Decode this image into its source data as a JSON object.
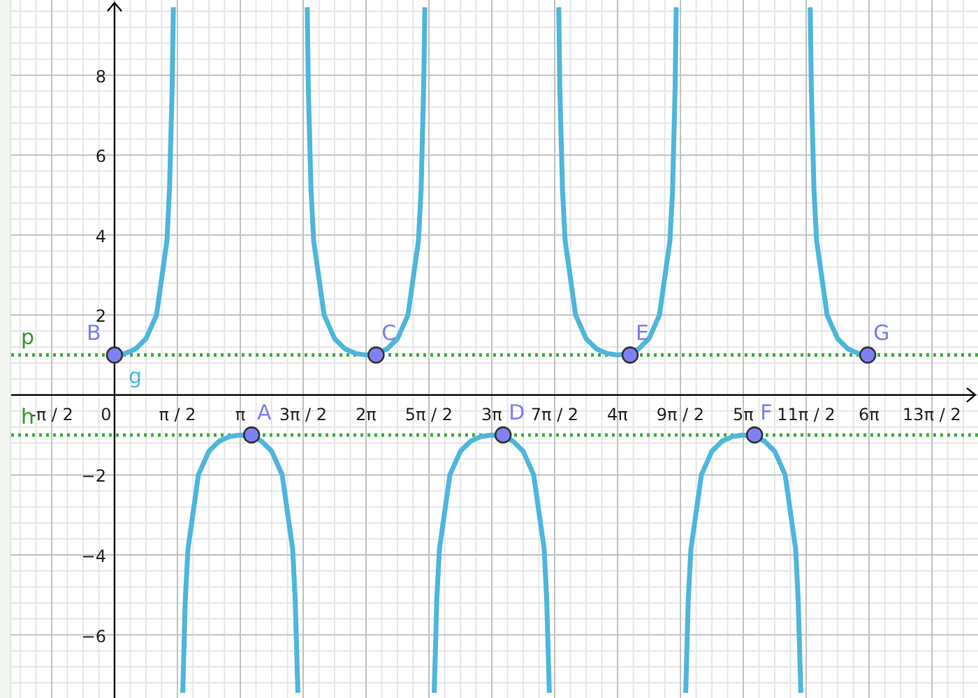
{
  "chart_data": {
    "type": "line",
    "xlim": [
      -2.582,
      21.573
    ],
    "ylim": [
      -7.58,
      9.88
    ],
    "grid": true,
    "xticks": [
      {
        "value": -1.571,
        "label": "-π / 2"
      },
      {
        "value": 0,
        "label": "0"
      },
      {
        "value": 1.571,
        "label": "π / 2"
      },
      {
        "value": 3.142,
        "label": "π"
      },
      {
        "value": 4.712,
        "label": "3π / 2"
      },
      {
        "value": 6.283,
        "label": "2π"
      },
      {
        "value": 7.854,
        "label": "5π / 2"
      },
      {
        "value": 9.425,
        "label": "3π"
      },
      {
        "value": 10.996,
        "label": "7π / 2"
      },
      {
        "value": 12.566,
        "label": "4π"
      },
      {
        "value": 14.137,
        "label": "9π / 2"
      },
      {
        "value": 15.708,
        "label": "5π"
      },
      {
        "value": 17.279,
        "label": "11π / 2"
      },
      {
        "value": 18.85,
        "label": "6π"
      },
      {
        "value": 20.42,
        "label": "13π / 2"
      }
    ],
    "yticks": [
      {
        "value": -6,
        "label": "−6"
      },
      {
        "value": -4,
        "label": "−4"
      },
      {
        "value": -2,
        "label": "−2"
      },
      {
        "value": 2,
        "label": "2"
      },
      {
        "value": 4,
        "label": "4"
      },
      {
        "value": 6,
        "label": "6"
      },
      {
        "value": 8,
        "label": "8"
      }
    ],
    "x": [
      0,
      0.262,
      0.524,
      0.785,
      1.047,
      1.309,
      1.374,
      1.44,
      1.469,
      1.571,
      1.704,
      1.767,
      1.833,
      2.094,
      2.356,
      2.618,
      2.88,
      3.142,
      3.403,
      3.665,
      3.927,
      4.189,
      4.451,
      4.516,
      4.58,
      4.712,
      4.814,
      4.843,
      4.909,
      4.974,
      5.236,
      5.498,
      5.76,
      6.021,
      6.283,
      6.545,
      6.807,
      7.069,
      7.33,
      7.592,
      7.658,
      7.723,
      7.752,
      7.854,
      7.987,
      8.05,
      8.116,
      8.378,
      8.639,
      8.901,
      9.163,
      9.425,
      9.687,
      9.948,
      10.21,
      10.472,
      10.734,
      10.799,
      10.863,
      10.996,
      11.097,
      11.127,
      11.192,
      11.257,
      11.519,
      11.781,
      12.043,
      12.305,
      12.566,
      12.828,
      13.09,
      13.352,
      13.614,
      13.875,
      13.941,
      14.006,
      14.035,
      14.137,
      14.27,
      14.334,
      14.399,
      14.661,
      14.923,
      15.184,
      15.446,
      15.708,
      15.97,
      16.232,
      16.493,
      16.755,
      17.017,
      17.082,
      17.146,
      17.279,
      17.381,
      17.41,
      17.475,
      17.541,
      17.802,
      18.064,
      18.326,
      18.588,
      18.85
    ],
    "series": [
      {
        "name": "g",
        "color": "#4db6dc",
        "values": [
          1,
          1.04,
          1.15,
          1.41,
          2,
          3.86,
          5.13,
          7.66,
          9.7,
          null,
          -7.45,
          -5.13,
          -3.86,
          -2,
          -1.41,
          -1.15,
          -1.04,
          -1,
          -1.04,
          -1.15,
          -1.41,
          -2,
          -3.86,
          -5.13,
          -7.45,
          null,
          9.7,
          7.66,
          5.13,
          3.86,
          2,
          1.41,
          1.15,
          1.04,
          1,
          1.04,
          1.15,
          1.41,
          2,
          3.86,
          5.13,
          7.66,
          9.7,
          null,
          -7.45,
          -5.13,
          -3.86,
          -2,
          -1.41,
          -1.15,
          -1.04,
          -1,
          -1.04,
          -1.15,
          -1.41,
          -2,
          -3.86,
          -5.13,
          -7.45,
          null,
          9.7,
          7.66,
          5.13,
          3.86,
          2,
          1.41,
          1.15,
          1.04,
          1,
          1.04,
          1.15,
          1.41,
          2,
          3.86,
          5.13,
          7.66,
          9.7,
          null,
          -7.45,
          -5.13,
          -3.86,
          -2,
          -1.41,
          -1.15,
          -1.04,
          -1,
          -1.04,
          -1.15,
          -1.41,
          -2,
          -3.86,
          -5.13,
          -7.45,
          null,
          9.7,
          7.66,
          5.13,
          3.86,
          2,
          1.41,
          1.15,
          1.04,
          1
        ]
      }
    ],
    "ref_lines": [
      {
        "axis": "y",
        "value": 1,
        "label": "p"
      },
      {
        "axis": "y",
        "value": -1,
        "label": "h"
      }
    ],
    "annotations": [
      {
        "text": "B",
        "x": 0,
        "y": 1
      },
      {
        "text": "A",
        "x": 3.424,
        "y": -1
      },
      {
        "text": "C",
        "x": 6.535,
        "y": 1
      },
      {
        "text": "D",
        "x": 9.708,
        "y": -1
      },
      {
        "text": "E",
        "x": 12.881,
        "y": 1
      },
      {
        "text": "F",
        "x": 15.991,
        "y": -1
      },
      {
        "text": "G",
        "x": 18.818,
        "y": 1
      }
    ]
  }
}
